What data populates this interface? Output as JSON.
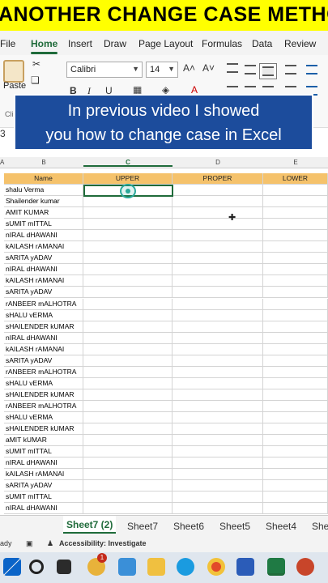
{
  "banner": {
    "text": "ANOTHER CHANGE CASE METHOD"
  },
  "menu": {
    "tabs": [
      "File",
      "Home",
      "Insert",
      "Draw",
      "Page Layout",
      "Formulas",
      "Data",
      "Review"
    ]
  },
  "ribbon": {
    "paste_label": "Paste",
    "clipboard_label": "Cli",
    "font_name": "Calibri",
    "font_size": "14",
    "grow_font": "A˄",
    "shrink_font": "A˅",
    "bold": "B",
    "italic": "I",
    "underline": "U"
  },
  "overlay": {
    "line1": "In previous video I showed",
    "line2": "you how to change case in Excel"
  },
  "formula": {
    "cell_ref": "3"
  },
  "columns": [
    "A",
    "B",
    "C",
    "D",
    "E"
  ],
  "table": {
    "headers": [
      "Name",
      "UPPER",
      "PROPER",
      "LOWER"
    ],
    "rows": [
      "shalu Verma",
      "Shailender kumar",
      "AMIT KUMAR",
      "sUMIT mITTAL",
      "nIRAL dHAWANI",
      "kAILASH rAMANAI",
      "sARITA yADAV",
      "nIRAL dHAWANI",
      "kAILASH rAMANAI",
      "sARITA yADAV",
      "rANBEER mALHOTRA",
      "sHALU vERMA",
      "sHAILENDER kUMAR",
      "nIRAL dHAWANI",
      "kAILASH rAMANAI",
      "sARITA yADAV",
      "rANBEER mALHOTRA",
      "sHALU vERMA",
      "sHAILENDER kUMAR",
      "rANBEER mALHOTRA",
      "sHALU vERMA",
      "sHAILENDER kUMAR",
      "aMIT kUMAR",
      "sUMIT mITTAL",
      "nIRAL dHAWANI",
      "kAILASH rAMANAI",
      "sARITA yADAV",
      "sUMIT mITTAL",
      "nIRAL dHAWANI"
    ]
  },
  "sheets": [
    "Sheet7 (2)",
    "Sheet7",
    "Sheet6",
    "Sheet5",
    "Sheet4",
    "She"
  ],
  "status": {
    "ready": "ady",
    "accessibility": "Accessibility: Investigate"
  },
  "taskbar": {
    "badge": "1"
  }
}
